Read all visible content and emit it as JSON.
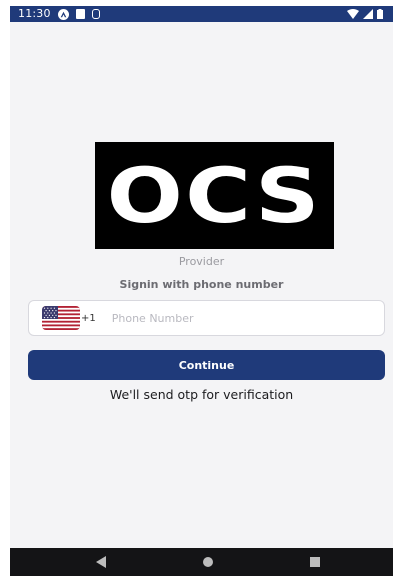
{
  "status_bar": {
    "time": "11:30",
    "icons": [
      "a-circle-icon",
      "sd-card-icon",
      "database-icon",
      "wifi-icon",
      "signal-icon",
      "battery-icon"
    ]
  },
  "logo": {
    "text": "OCS"
  },
  "provider_label": "Provider",
  "signin_label": "Signin with phone number",
  "phone": {
    "country_code": "+1",
    "placeholder": "Phone Number",
    "value": ""
  },
  "continue_label": "Continue",
  "otp_note": "We'll send otp for verification",
  "colors": {
    "primary": "#1f3a7a",
    "background": "#f4f4f6",
    "nav": "#141416"
  }
}
